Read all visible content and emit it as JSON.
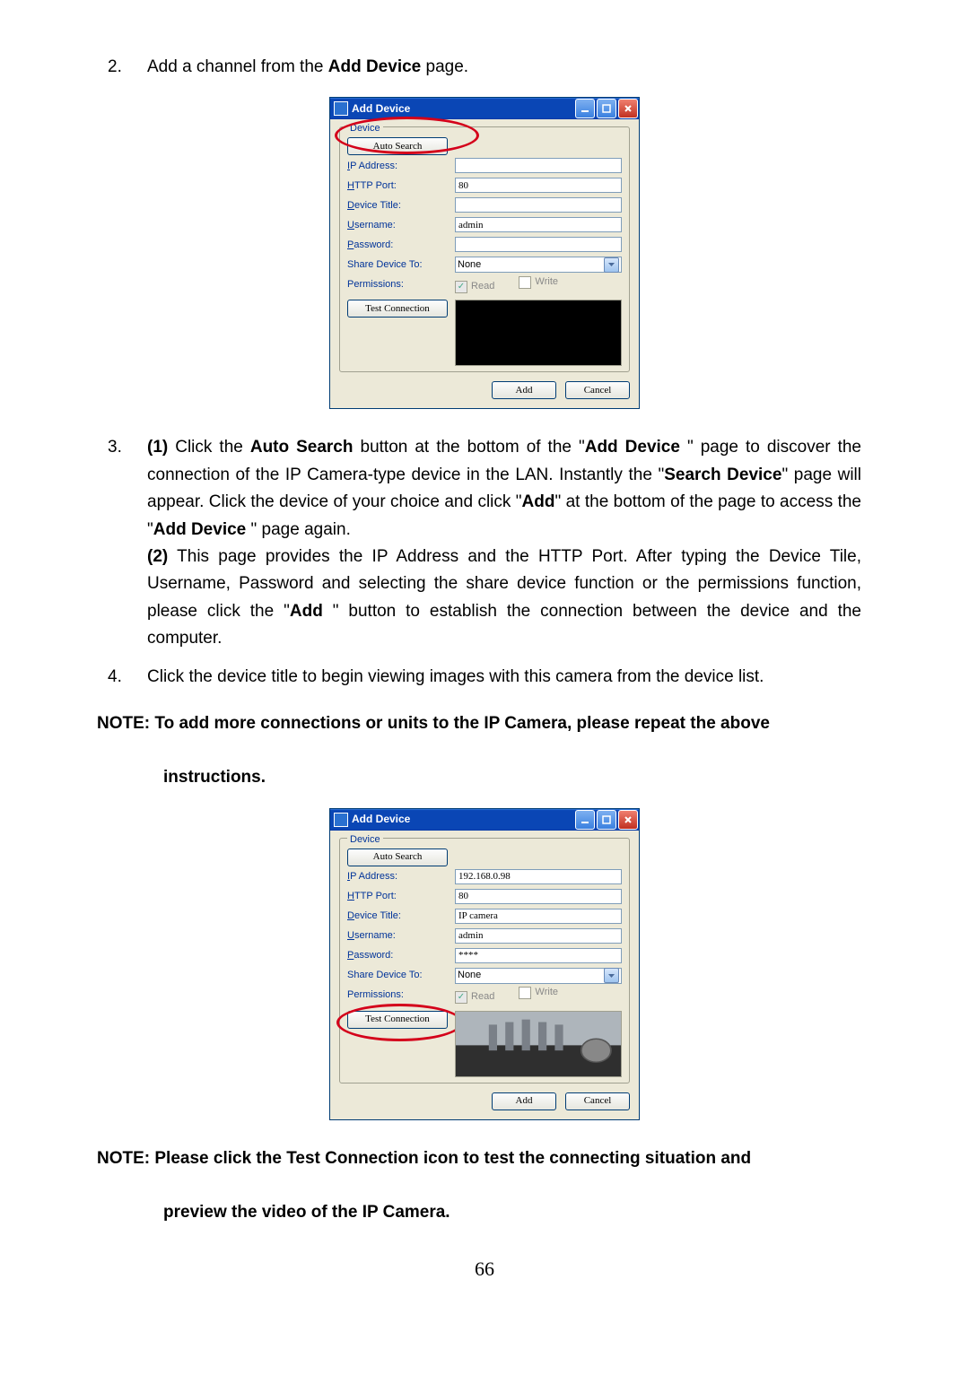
{
  "step2": {
    "num": "2.",
    "text_a": "Add a channel from the ",
    "bold": "Add Device",
    "text_b": " page."
  },
  "dlg1": {
    "title": "Add Device",
    "legend": "Device",
    "auto_search": "Auto Search",
    "ip_label": "IP Address:",
    "http_label": "HTTP Port:",
    "http_val": "80",
    "devtitle_label": "Device Title:",
    "user_label": "Username:",
    "user_val": "admin",
    "pass_label": "Password:",
    "share_label": "Share Device To:",
    "share_val": "None",
    "perm_label": "Permissions:",
    "read": "Read",
    "write": "Write",
    "test": "Test Connection",
    "add": "Add",
    "cancel": "Cancel"
  },
  "step3": {
    "num": "3.",
    "p1a": "(1)",
    "p1b": " Click the ",
    "p1c": "Auto Search",
    "p1d": " button at the bottom of the \"",
    "p1e": "Add Device ",
    "p1f": "\" page to discover the connection of the IP Camera-type device in the LAN. Instantly the \"",
    "p1g": "Search Device",
    "p1h": "\" page will appear. Click the device of your choice and click \"",
    "p1i": "Add",
    "p1j": "\" at the bottom of the page to access the \"",
    "p1k": "Add Device ",
    "p1l": "\" page again.",
    "p2a": "(2)",
    "p2b": " This page provides the IP Address and the HTTP Port. After typing the Device Tile, Username, Password and selecting the share device function or the permissions function, please click the \"",
    "p2c": "Add ",
    "p2d": "\" button to establish the connection between the device and the computer."
  },
  "step4": {
    "num": "4.",
    "text": "Click the device title to begin viewing images with this camera from the device list."
  },
  "note1a": "NOTE: To add more connections or units to the IP Camera, please repeat the above",
  "note1b": "instructions.",
  "dlg2": {
    "title": "Add Device",
    "legend": "Device",
    "auto_search": "Auto Search",
    "ip_label": "IP Address:",
    "ip_val": "192.168.0.98",
    "http_label": "HTTP Port:",
    "http_val": "80",
    "devtitle_label": "Device Title:",
    "devtitle_val": "IP camera",
    "user_label": "Username:",
    "user_val": "admin",
    "pass_label": "Password:",
    "pass_val": "****",
    "share_label": "Share Device To:",
    "share_val": "None",
    "perm_label": "Permissions:",
    "read": "Read",
    "write": "Write",
    "test": "Test Connection",
    "add": "Add",
    "cancel": "Cancel"
  },
  "note2a": "NOTE: Please click the Test Connection icon to test the connecting situation and",
  "note2b": "preview the video of the IP Camera.",
  "page_num": "66"
}
